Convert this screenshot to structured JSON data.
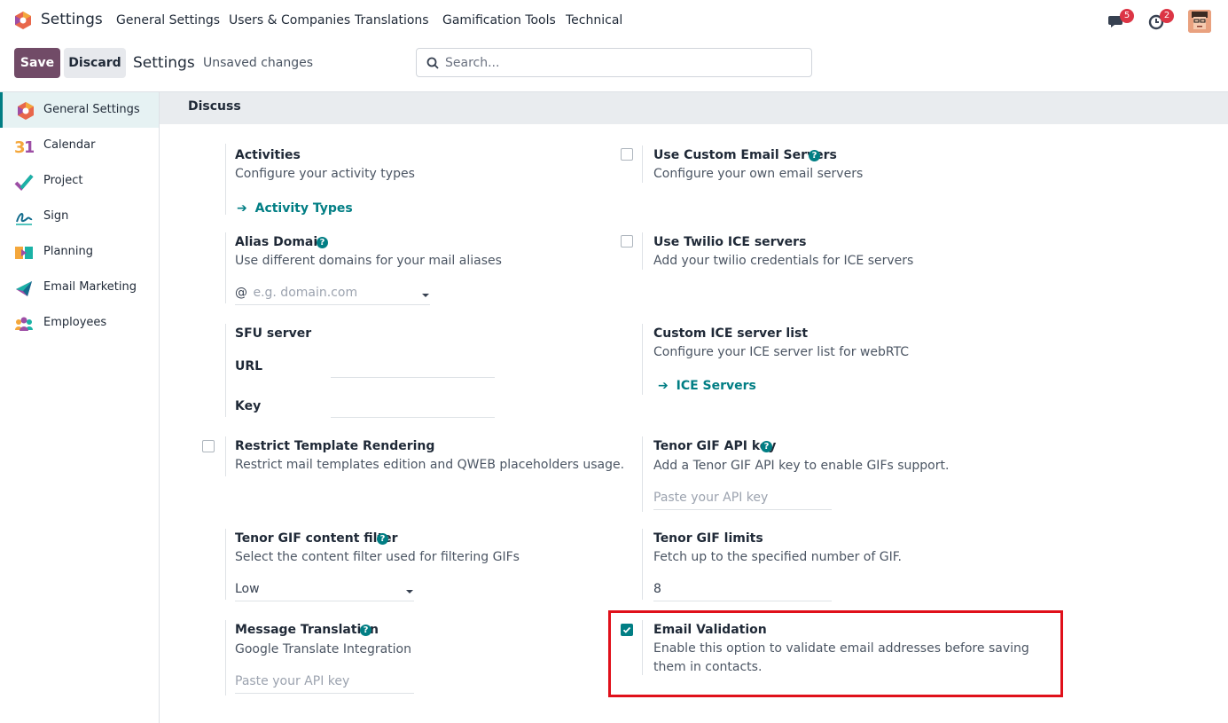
{
  "navbar": {
    "app_name": "Settings",
    "menu": [
      "General Settings",
      "Users & Companies",
      "Translations",
      "Gamification Tools",
      "Technical"
    ],
    "messages_count": "5",
    "activities_count": "2",
    "icons": [
      "app-logo-icon",
      "chat-icon",
      "clock-icon",
      "user-avatar"
    ]
  },
  "control": {
    "save_label": "Save",
    "discard_label": "Discard",
    "title": "Settings",
    "status": "Unsaved changes",
    "search_placeholder": "Search..."
  },
  "sidebar": {
    "items": [
      {
        "label": "General Settings",
        "icon": "odoo-settings-icon",
        "active": true
      },
      {
        "label": "Calendar",
        "icon": "calendar-icon"
      },
      {
        "label": "Project",
        "icon": "project-icon"
      },
      {
        "label": "Sign",
        "icon": "sign-icon"
      },
      {
        "label": "Planning",
        "icon": "planning-icon"
      },
      {
        "label": "Email Marketing",
        "icon": "email-marketing-icon"
      },
      {
        "label": "Employees",
        "icon": "employees-icon"
      }
    ]
  },
  "section": {
    "title": "Discuss"
  },
  "settings": {
    "activities": {
      "title": "Activities",
      "desc": "Configure your activity types",
      "link": "Activity Types"
    },
    "custom_email": {
      "title": "Use Custom Email Servers",
      "desc": "Configure your own email servers",
      "checked": false
    },
    "alias_domain": {
      "title": "Alias Domain",
      "desc": "Use different domains for your mail aliases",
      "prefix": "@",
      "placeholder": "e.g. domain.com"
    },
    "twilio": {
      "title": "Use Twilio ICE servers",
      "desc": "Add your twilio credentials for ICE servers",
      "checked": false
    },
    "sfu": {
      "title": "SFU server",
      "url_label": "URL",
      "key_label": "Key"
    },
    "ice_list": {
      "title": "Custom ICE server list",
      "desc": "Configure your ICE server list for webRTC",
      "link": "ICE Servers"
    },
    "restrict": {
      "title": "Restrict Template Rendering",
      "desc": "Restrict mail templates edition and QWEB placeholders usage.",
      "checked": false
    },
    "tenor_key": {
      "title": "Tenor GIF API key",
      "desc": "Add a Tenor GIF API key to enable GIFs support.",
      "placeholder": "Paste your API key"
    },
    "tenor_filter": {
      "title": "Tenor GIF content filter",
      "desc": "Select the content filter used for filtering GIFs",
      "value": "Low"
    },
    "tenor_limits": {
      "title": "Tenor GIF limits",
      "desc": "Fetch up to the specified number of GIF.",
      "value": "8"
    },
    "translation": {
      "title": "Message Translation",
      "desc": "Google Translate Integration",
      "placeholder": "Paste your API key"
    },
    "email_validation": {
      "title": "Email Validation",
      "desc_line1": "Enable this option to validate email addresses before saving",
      "desc_line2": "them in contacts.",
      "checked": true
    }
  },
  "colors": {
    "brand": "#714b67",
    "accent": "#017e84",
    "highlight": "#e0101a"
  }
}
